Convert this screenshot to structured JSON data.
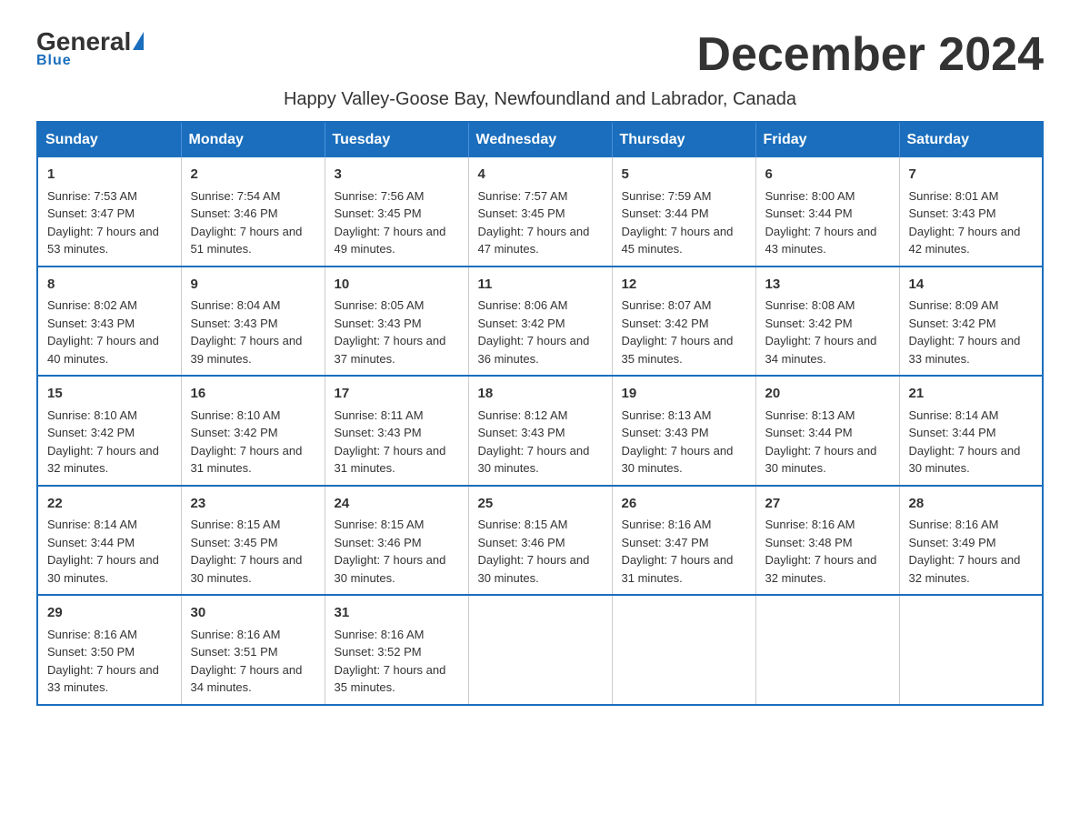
{
  "header": {
    "logo_general": "General",
    "logo_blue": "Blue",
    "month_title": "December 2024",
    "subtitle": "Happy Valley-Goose Bay, Newfoundland and Labrador, Canada"
  },
  "days_of_week": [
    "Sunday",
    "Monday",
    "Tuesday",
    "Wednesday",
    "Thursday",
    "Friday",
    "Saturday"
  ],
  "weeks": [
    [
      {
        "day": "1",
        "sunrise": "7:53 AM",
        "sunset": "3:47 PM",
        "daylight": "7 hours and 53 minutes."
      },
      {
        "day": "2",
        "sunrise": "7:54 AM",
        "sunset": "3:46 PM",
        "daylight": "7 hours and 51 minutes."
      },
      {
        "day": "3",
        "sunrise": "7:56 AM",
        "sunset": "3:45 PM",
        "daylight": "7 hours and 49 minutes."
      },
      {
        "day": "4",
        "sunrise": "7:57 AM",
        "sunset": "3:45 PM",
        "daylight": "7 hours and 47 minutes."
      },
      {
        "day": "5",
        "sunrise": "7:59 AM",
        "sunset": "3:44 PM",
        "daylight": "7 hours and 45 minutes."
      },
      {
        "day": "6",
        "sunrise": "8:00 AM",
        "sunset": "3:44 PM",
        "daylight": "7 hours and 43 minutes."
      },
      {
        "day": "7",
        "sunrise": "8:01 AM",
        "sunset": "3:43 PM",
        "daylight": "7 hours and 42 minutes."
      }
    ],
    [
      {
        "day": "8",
        "sunrise": "8:02 AM",
        "sunset": "3:43 PM",
        "daylight": "7 hours and 40 minutes."
      },
      {
        "day": "9",
        "sunrise": "8:04 AM",
        "sunset": "3:43 PM",
        "daylight": "7 hours and 39 minutes."
      },
      {
        "day": "10",
        "sunrise": "8:05 AM",
        "sunset": "3:43 PM",
        "daylight": "7 hours and 37 minutes."
      },
      {
        "day": "11",
        "sunrise": "8:06 AM",
        "sunset": "3:42 PM",
        "daylight": "7 hours and 36 minutes."
      },
      {
        "day": "12",
        "sunrise": "8:07 AM",
        "sunset": "3:42 PM",
        "daylight": "7 hours and 35 minutes."
      },
      {
        "day": "13",
        "sunrise": "8:08 AM",
        "sunset": "3:42 PM",
        "daylight": "7 hours and 34 minutes."
      },
      {
        "day": "14",
        "sunrise": "8:09 AM",
        "sunset": "3:42 PM",
        "daylight": "7 hours and 33 minutes."
      }
    ],
    [
      {
        "day": "15",
        "sunrise": "8:10 AM",
        "sunset": "3:42 PM",
        "daylight": "7 hours and 32 minutes."
      },
      {
        "day": "16",
        "sunrise": "8:10 AM",
        "sunset": "3:42 PM",
        "daylight": "7 hours and 31 minutes."
      },
      {
        "day": "17",
        "sunrise": "8:11 AM",
        "sunset": "3:43 PM",
        "daylight": "7 hours and 31 minutes."
      },
      {
        "day": "18",
        "sunrise": "8:12 AM",
        "sunset": "3:43 PM",
        "daylight": "7 hours and 30 minutes."
      },
      {
        "day": "19",
        "sunrise": "8:13 AM",
        "sunset": "3:43 PM",
        "daylight": "7 hours and 30 minutes."
      },
      {
        "day": "20",
        "sunrise": "8:13 AM",
        "sunset": "3:44 PM",
        "daylight": "7 hours and 30 minutes."
      },
      {
        "day": "21",
        "sunrise": "8:14 AM",
        "sunset": "3:44 PM",
        "daylight": "7 hours and 30 minutes."
      }
    ],
    [
      {
        "day": "22",
        "sunrise": "8:14 AM",
        "sunset": "3:44 PM",
        "daylight": "7 hours and 30 minutes."
      },
      {
        "day": "23",
        "sunrise": "8:15 AM",
        "sunset": "3:45 PM",
        "daylight": "7 hours and 30 minutes."
      },
      {
        "day": "24",
        "sunrise": "8:15 AM",
        "sunset": "3:46 PM",
        "daylight": "7 hours and 30 minutes."
      },
      {
        "day": "25",
        "sunrise": "8:15 AM",
        "sunset": "3:46 PM",
        "daylight": "7 hours and 30 minutes."
      },
      {
        "day": "26",
        "sunrise": "8:16 AM",
        "sunset": "3:47 PM",
        "daylight": "7 hours and 31 minutes."
      },
      {
        "day": "27",
        "sunrise": "8:16 AM",
        "sunset": "3:48 PM",
        "daylight": "7 hours and 32 minutes."
      },
      {
        "day": "28",
        "sunrise": "8:16 AM",
        "sunset": "3:49 PM",
        "daylight": "7 hours and 32 minutes."
      }
    ],
    [
      {
        "day": "29",
        "sunrise": "8:16 AM",
        "sunset": "3:50 PM",
        "daylight": "7 hours and 33 minutes."
      },
      {
        "day": "30",
        "sunrise": "8:16 AM",
        "sunset": "3:51 PM",
        "daylight": "7 hours and 34 minutes."
      },
      {
        "day": "31",
        "sunrise": "8:16 AM",
        "sunset": "3:52 PM",
        "daylight": "7 hours and 35 minutes."
      },
      null,
      null,
      null,
      null
    ]
  ]
}
